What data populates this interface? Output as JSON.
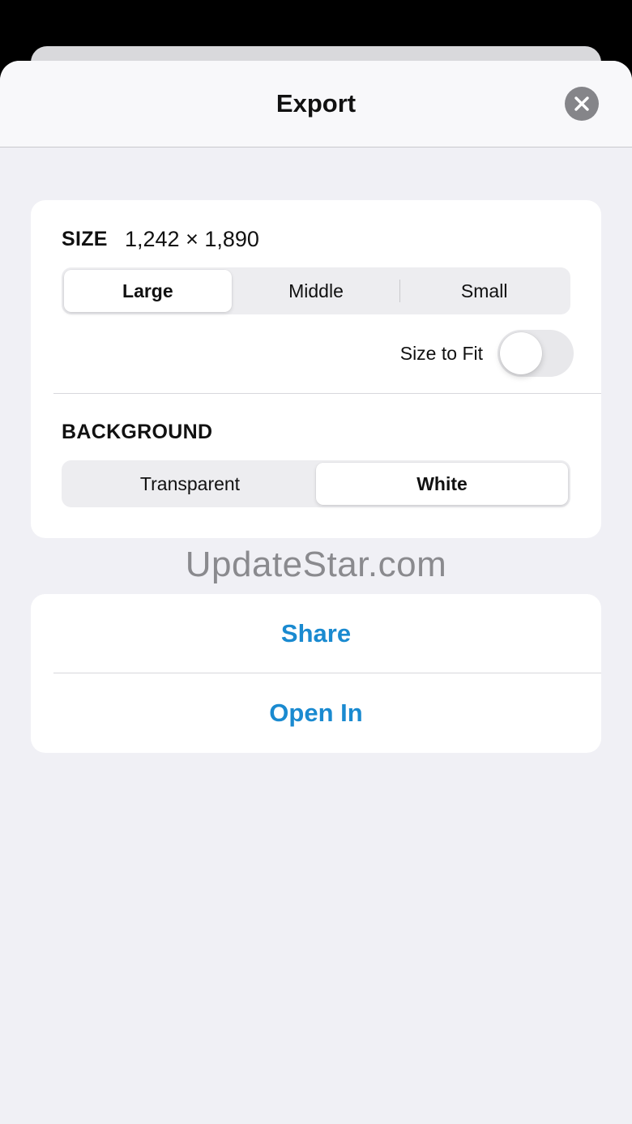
{
  "header": {
    "title": "Export",
    "close_icon": "close-icon"
  },
  "size": {
    "label": "SIZE",
    "dimensions": "1,242 × 1,890",
    "options": [
      "Large",
      "Middle",
      "Small"
    ],
    "selected": "Large",
    "fit_label": "Size to Fit",
    "fit_enabled": false
  },
  "background": {
    "label": "BACKGROUND",
    "options": [
      "Transparent",
      "White"
    ],
    "selected": "White"
  },
  "watermark": "UpdateStar.com",
  "actions": {
    "share": "Share",
    "open_in": "Open In"
  },
  "colors": {
    "accent": "#1a8ad0",
    "sheet_background": "#f0f0f5",
    "toggle_off": "#e8e8eb"
  }
}
